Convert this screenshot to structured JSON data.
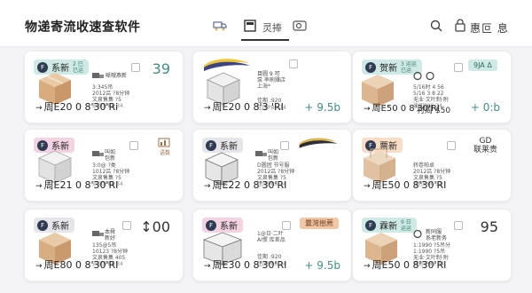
{
  "app": {
    "title": "物递寄流收速查软件"
  },
  "header": {
    "tab_label": "灵捧",
    "user_name": "惠叵 息"
  },
  "colors": {
    "accent": "#3f8f86",
    "badge_mint": "#cfe9e4",
    "badge_pink": "#f3d3e2",
    "badge_grey": "#e6e6ea",
    "badge_peach": "#f7dcc7"
  },
  "cards": [
    {
      "badge": "系新",
      "badge_sub": "2 已\n已运",
      "corner": "39",
      "info_label": "哌哦燕新",
      "info_lines": [
        "3:345吊",
        "2012吕 ?8分钟",
        "文泉售集 ?5",
        "运运|P86 34"
      ],
      "date": "周E20 0 8'30'Ri",
      "side": ""
    },
    {
      "badge": "",
      "badge_sub": "",
      "corner": "",
      "info_label": "目圆 9 可",
      "info_lines": [
        "泵 率刷赚店",
        "上海*"
      ],
      "info_lines2": [
        "佳期 :920",
        "佳团P86 34"
      ],
      "date": "周E20 0 8'3 'RI",
      "side": "+ 9.5b"
    },
    {
      "badge": "贺新",
      "badge_sub": "3 运运\n已运",
      "corner": "9JA Δ",
      "info_label": "",
      "info_lines": [
        "5/16时 4 56",
        "5/16 3 8 22",
        "无业·文叶制·附",
        "佳团P86 34"
      ],
      "date": "周E50 0 8'30'RI",
      "side": "+ 0:b",
      "mid": "衬周 $50"
    },
    {
      "badge": "系新",
      "badge_sub": "",
      "corner": "",
      "info_label": "叫如\n包新",
      "info_lines": [
        "3:0@ ?类",
        "1012吕 ?8分钟",
        "文泉售集 ?5",
        "运运|P86 34"
      ],
      "date": "周E21 0 8'30'RI",
      "side": "",
      "icon_label": "语数"
    },
    {
      "badge": "系新",
      "badge_sub": "",
      "corner": "",
      "info_label": "叫如\n包新",
      "info_lines": [
        "D圆团 节号服",
        "2012吕 ?8分钟",
        "文泉售集 ?5",
        "佳团P86 34"
      ],
      "date": "周E22 0 8'30'RI",
      "side": ""
    },
    {
      "badge": "票新",
      "badge_sub": "",
      "corner": "GD\n联莱贵",
      "info_label": "",
      "info_lines": [
        "转卷帕卓",
        "2012吕 ?8分钟",
        "文泉售集 ?5",
        "佳团P86 34"
      ],
      "date": "周E50 0 8'30'RI",
      "side": ""
    },
    {
      "badge": "系新",
      "badge_sub": "",
      "corner": "↕00",
      "info_label": "本舜\n新好",
      "info_lines": [
        "135@5吊",
        "10123 ?8分钟",
        "文泉售集 405",
        "运运|P86 34"
      ],
      "date": "周E80 0 8'30'RI",
      "side": ""
    },
    {
      "badge": "系新",
      "badge_sub": "",
      "corner": "",
      "info_label": "",
      "info_lines": [
        "1@日·二叶",
        "AI惯 库差品",
        "佳期 :920",
        "佳团P86 34"
      ],
      "date": "周E30 0 8'30'RI",
      "side": "+ 9.5b",
      "tag": "曩灣樹薦"
    },
    {
      "badge": "霖新",
      "badge_sub": "9 日\n运运",
      "corner": "95",
      "info_label": "新同服\n系老新务",
      "info_lines": [
        "1:1990 ?5吊分",
        "1:1990 ?5吊",
        "无业·文叶制·附",
        "运运|P86 34"
      ],
      "date": "周E50 0 8'30'RI",
      "side": ""
    }
  ]
}
